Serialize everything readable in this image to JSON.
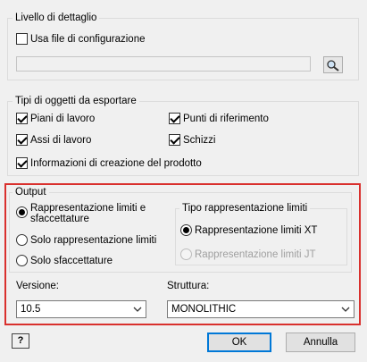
{
  "detail_level": {
    "title": "Livello di dettaglio",
    "use_config_file": {
      "label": "Usa file di configurazione",
      "checked": false
    },
    "config_path": {
      "value": ""
    }
  },
  "object_types": {
    "title": "Tipi di oggetti da esportare",
    "items": [
      {
        "label": "Piani di lavoro",
        "checked": true
      },
      {
        "label": "Punti di riferimento",
        "checked": true
      },
      {
        "label": "Assi di lavoro",
        "checked": true
      },
      {
        "label": "Schizzi",
        "checked": true
      },
      {
        "label": "Informazioni di creazione del prodotto",
        "checked": true
      }
    ]
  },
  "output": {
    "title": "Output",
    "options": [
      {
        "label_line1": "Rappresentazione limiti e",
        "label_line2": "sfaccettature",
        "selected": true
      },
      {
        "label": "Solo rappresentazione limiti",
        "selected": false
      },
      {
        "label": "Solo sfaccettature",
        "selected": false
      }
    ],
    "boundary_type": {
      "title": "Tipo rappresentazione limiti",
      "options": [
        {
          "label": "Rappresentazione limiti XT",
          "selected": true,
          "enabled": true
        },
        {
          "label": "Rappresentazione limiti JT",
          "selected": false,
          "enabled": false
        }
      ]
    },
    "version": {
      "label": "Versione:",
      "value": "10.5"
    },
    "structure": {
      "label": "Struttura:",
      "value": "MONOLITHIC"
    }
  },
  "footer": {
    "help_icon": "help-icon",
    "ok_label": "OK",
    "cancel_label": "Annulla"
  },
  "colors": {
    "highlight": "#d9302d",
    "default_button_border": "#0078d7",
    "background": "#f0f0f0"
  }
}
